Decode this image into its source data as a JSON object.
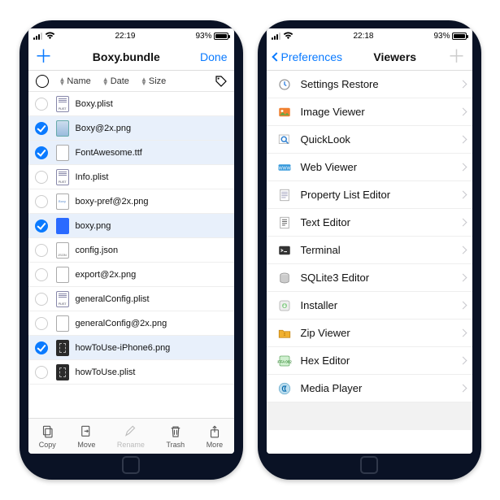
{
  "left": {
    "status": {
      "time": "22:19",
      "battery": "93%"
    },
    "nav": {
      "title": "Boxy.bundle",
      "done": "Done"
    },
    "columns": {
      "name": "Name",
      "date": "Date",
      "size": "Size"
    },
    "files": [
      {
        "name": "Boxy.plist",
        "selected": false,
        "type": "plist"
      },
      {
        "name": "Boxy@2x.png",
        "selected": true,
        "type": "img"
      },
      {
        "name": "FontAwesome.ttf",
        "selected": true,
        "type": "blank"
      },
      {
        "name": "Info.plist",
        "selected": false,
        "type": "plist"
      },
      {
        "name": "boxy-pref@2x.png",
        "selected": false,
        "type": "boxy"
      },
      {
        "name": "boxy.png",
        "selected": true,
        "type": "grid"
      },
      {
        "name": "config.json",
        "selected": false,
        "type": "json"
      },
      {
        "name": "export@2x.png",
        "selected": false,
        "type": "blank"
      },
      {
        "name": "generalConfig.plist",
        "selected": false,
        "type": "plist"
      },
      {
        "name": "generalConfig@2x.png",
        "selected": false,
        "type": "blank"
      },
      {
        "name": "howToUse-iPhone6.png",
        "selected": true,
        "type": "dark"
      },
      {
        "name": "howToUse.plist",
        "selected": false,
        "type": "dark"
      }
    ],
    "toolbar": {
      "copy": "Copy",
      "move": "Move",
      "rename": "Rename",
      "trash": "Trash",
      "more": "More"
    }
  },
  "right": {
    "status": {
      "time": "22:18",
      "battery": "93%"
    },
    "nav": {
      "back": "Preferences",
      "title": "Viewers"
    },
    "viewers": [
      {
        "label": "Settings Restore",
        "color": "#e8e8e8",
        "glyph": "clock"
      },
      {
        "label": "Image Viewer",
        "color": "#f08030",
        "glyph": "image"
      },
      {
        "label": "QuickLook",
        "color": "#e8e8e8",
        "glyph": "search"
      },
      {
        "label": "Web Viewer",
        "color": "#3498db",
        "glyph": "www"
      },
      {
        "label": "Property List Editor",
        "color": "#e8e8e8",
        "glyph": "plist"
      },
      {
        "label": "Text Editor",
        "color": "#e8e8e8",
        "glyph": "text"
      },
      {
        "label": "Terminal",
        "color": "#333333",
        "glyph": "term"
      },
      {
        "label": "SQLite3 Editor",
        "color": "#b0b0b0",
        "glyph": "db"
      },
      {
        "label": "Installer",
        "color": "#e8e8e8",
        "glyph": "install"
      },
      {
        "label": "Zip Viewer",
        "color": "#f0b030",
        "glyph": "zip"
      },
      {
        "label": "Hex Editor",
        "color": "#80d080",
        "glyph": "hex"
      },
      {
        "label": "Media Player",
        "color": "#60b0e0",
        "glyph": "media"
      }
    ]
  }
}
